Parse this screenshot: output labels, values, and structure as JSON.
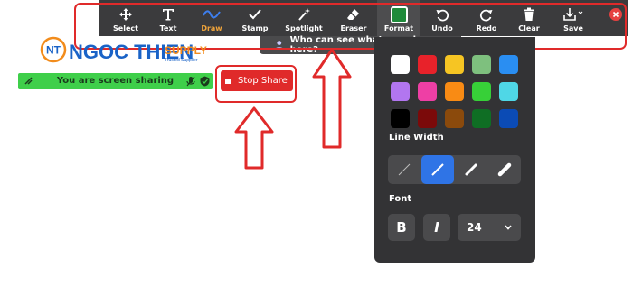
{
  "toolbar": {
    "tools": [
      {
        "label": "Select",
        "icon": "move-arrows-icon"
      },
      {
        "label": "Text",
        "icon": "text-T-icon"
      },
      {
        "label": "Draw",
        "icon": "squiggle-line-icon"
      },
      {
        "label": "Stamp",
        "icon": "checkmark-icon"
      },
      {
        "label": "Spotlight",
        "icon": "magic-wand-icon"
      },
      {
        "label": "Eraser",
        "icon": "eraser-icon"
      },
      {
        "label": "Format",
        "icon": "color-square-icon"
      },
      {
        "label": "Undo",
        "icon": "undo-icon"
      },
      {
        "label": "Redo",
        "icon": "redo-icon"
      },
      {
        "label": "Clear",
        "icon": "trash-icon"
      },
      {
        "label": "Save",
        "icon": "save-download-icon"
      }
    ],
    "active_tool": "Draw",
    "selected_tool": "Format",
    "format_color": "#1e8a3a"
  },
  "hint": {
    "text": "Who can see what you share here?"
  },
  "logo": {
    "badge": "NT",
    "name": "NGOC THIEN",
    "suffix": "SUPPLY",
    "tagline": "Trusted Supplier"
  },
  "share_bar": {
    "text": "You are screen sharing",
    "stop_label": "Stop Share"
  },
  "format_panel": {
    "colors": [
      "#ffffff",
      "#e8222a",
      "#f6c523",
      "#7ec07e",
      "#2a8ef2",
      "#b276f0",
      "#ee3fa5",
      "#f98b14",
      "#37d038",
      "#4fd7e6",
      "#000000",
      "#7b0a0a",
      "#8b4a0c",
      "#0f6e24",
      "#0b4bb5"
    ],
    "line_width_label": "Line Width",
    "selected_line_width": 2,
    "font_label": "Font",
    "bold_label": "B",
    "italic_label": "I",
    "font_size": "24"
  },
  "colors": {
    "toolbar_bg": "#3b3b3d",
    "panel_bg": "#333335",
    "share_green": "#3fcf4a",
    "stop_red": "#e02a2a",
    "active_orange": "#f0a43a",
    "selected_blue": "#2f74e6"
  }
}
